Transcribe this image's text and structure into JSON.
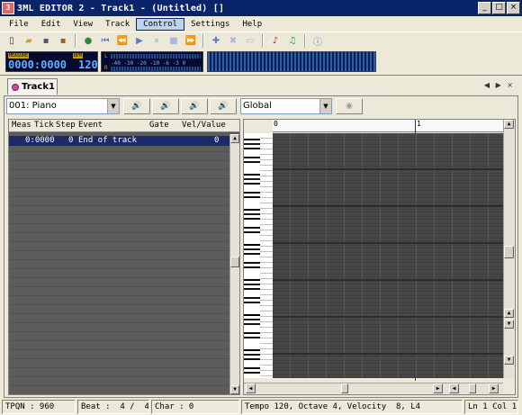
{
  "window": {
    "title": "3ML EDITOR 2 - Track1 - (Untitled) []",
    "app_icon_text": "3",
    "buttons": {
      "minimize": "_",
      "maximize": "□",
      "close": "×"
    }
  },
  "menu": [
    "File",
    "Edit",
    "View",
    "Track",
    "Control",
    "Settings",
    "Help"
  ],
  "toolbar": {
    "buttons": [
      "new-icon",
      "open-icon",
      "save-icon",
      "save-as-icon",
      "record-icon",
      "rewind-start-icon",
      "rewind-icon",
      "play-icon",
      "pause-icon",
      "stop-icon",
      "forward-icon",
      "insert-icon",
      "delete-icon",
      "clear-icon",
      "mml-out-icon",
      "mml-in-icon",
      "info-icon"
    ]
  },
  "lcd": {
    "measure_label": "MEASURE",
    "bpm_label": "BPM",
    "position": "0000:0000",
    "tempo": "120",
    "level_labels": [
      "L",
      "R"
    ],
    "scale": "-40 -30 -20 -10 -6 -3 0"
  },
  "tab": {
    "label": "Track1",
    "nav": "◀ ▶ ×"
  },
  "controls": {
    "instrument": "001: Piano",
    "scope": "Global",
    "speaker_icons": [
      "🔊",
      "🔊",
      "🔊",
      "🔊"
    ]
  },
  "event_list": {
    "columns": {
      "meas": "Meas",
      "tick": "Tick",
      "step": "Step",
      "event": "Event",
      "gate": "Gate",
      "vel": "Vel/Value"
    },
    "rows": [
      {
        "meas_tick": "0:0000",
        "step": "0",
        "event": "End of track",
        "gate": "",
        "vel": "0"
      }
    ]
  },
  "piano_roll": {
    "measures": [
      "0",
      "1"
    ]
  },
  "status": {
    "tpqn": "TPQN : 960",
    "beat": "Beat :  4 /  4",
    "char": "Char : 0",
    "info": "Tempo 120, Octave 4, Velocity  8, L4",
    "pos": "Ln 1 Col 1"
  }
}
